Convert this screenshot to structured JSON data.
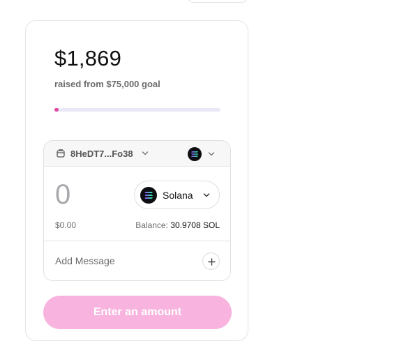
{
  "campaign": {
    "raised_amount": "$1,869",
    "raised_caption": "raised from $75,000 goal",
    "raised_value": 1869,
    "goal_value": 75000,
    "progress_fraction": 0.0249,
    "progress_color": "#e0469e"
  },
  "wallet": {
    "address": "8HeDT7...Fo38",
    "icon": "wallet-icon",
    "network_icon": "solana-icon"
  },
  "payment": {
    "amount": "0",
    "token": "Solana",
    "token_icon": "solana-icon",
    "usd_value": "$0.00",
    "balance_label": "Balance:",
    "balance_value": "30.9708 SOL"
  },
  "message": {
    "placeholder": "Add Message"
  },
  "submit": {
    "label": "Enter an amount",
    "color": "#f8b4df"
  }
}
